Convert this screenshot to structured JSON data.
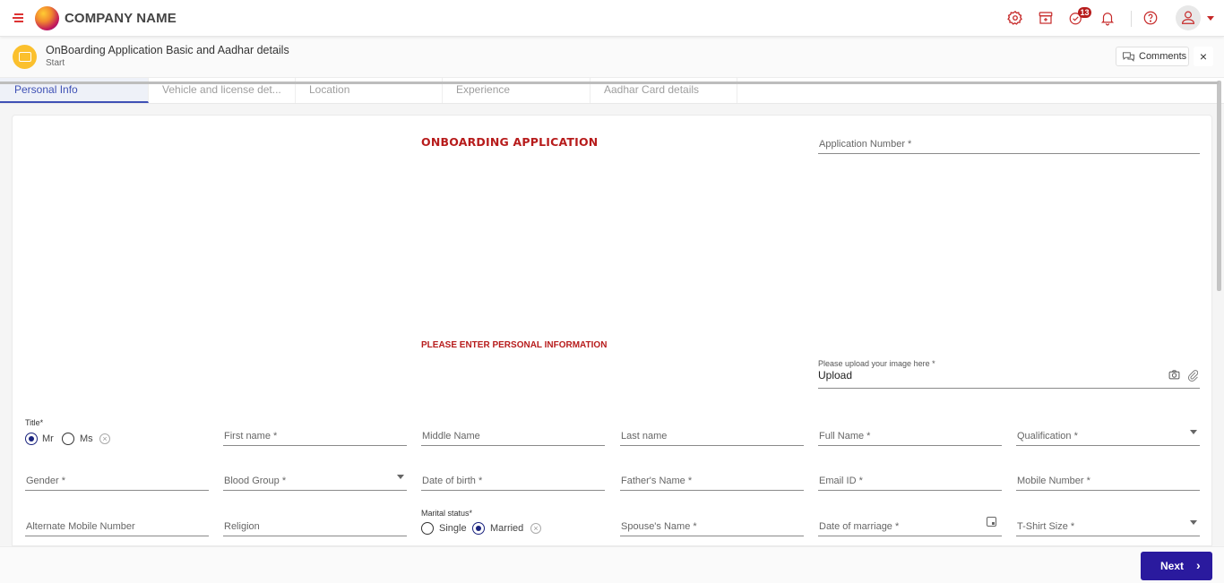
{
  "app": {
    "company_name": "COMPANY NAME",
    "badge_count": "13",
    "accent_color": "#c62828",
    "primary_color": "#2a1a9e"
  },
  "topbar_icons": [
    "gear-icon",
    "store-icon",
    "tasks-check-icon",
    "bell-icon",
    "help-icon",
    "user-avatar-icon"
  ],
  "process": {
    "title": "OnBoarding Application Basic and Aadhar details",
    "status": "Start",
    "comments_label": "Comments",
    "close_label": "×"
  },
  "tabs": [
    {
      "label": "Personal Info",
      "active": true
    },
    {
      "label": "Vehicle and license det...",
      "active": false
    },
    {
      "label": "Location",
      "active": false
    },
    {
      "label": "Experience",
      "active": false
    },
    {
      "label": "Aadhar Card details",
      "active": false
    }
  ],
  "form": {
    "heading": "ONBOARDING APPLICATION",
    "subheading": "PLEASE ENTER PERSONAL INFORMATION",
    "application_number": {
      "label": "Application Number *",
      "value": ""
    },
    "upload": {
      "label": "Please upload your image here *",
      "value": "Upload"
    },
    "title_group": {
      "label": "Title*",
      "options": [
        "Mr",
        "Ms"
      ],
      "selected": "Mr"
    },
    "marital_group": {
      "label": "Marital status*",
      "options": [
        "Single",
        "Married"
      ],
      "selected": "Married"
    },
    "fields": {
      "first_name": "First name *",
      "middle_name": "Middle Name",
      "last_name": "Last name",
      "full_name": "Full Name *",
      "qualification": "Qualification *",
      "gender": "Gender *",
      "blood_group": "Blood Group *",
      "date_of_birth": "Date of birth *",
      "fathers_name": "Father's Name *",
      "email_id": "Email ID *",
      "mobile_number": "Mobile Number *",
      "alternate_mobile": "Alternate Mobile Number",
      "religion": "Religion",
      "spouse_name": "Spouse's Name *",
      "date_of_marriage": "Date of marriage *",
      "tshirt_size": "T-Shirt Size *"
    }
  },
  "footer": {
    "next_label": "Next",
    "next_icon": "›"
  }
}
